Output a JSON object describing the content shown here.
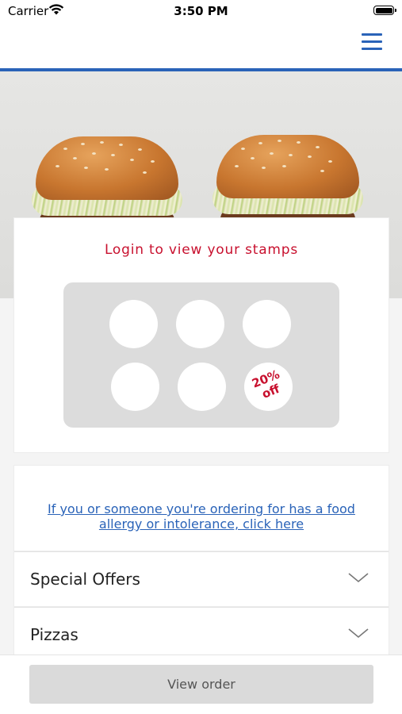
{
  "status_bar": {
    "carrier": "Carrier",
    "time": "3:50 PM"
  },
  "header": {
    "menu_icon": "hamburger-menu-icon"
  },
  "colors": {
    "brand_blue": "#2a63b8",
    "brand_red": "#c8102e"
  },
  "stamps": {
    "title": "Login to view your stamps",
    "reward_label": "20% off"
  },
  "allergy": {
    "link_text": "If you or someone you're ordering for has a food allergy or intolerance, click here"
  },
  "menu": {
    "sections": [
      {
        "label": "Special Offers",
        "icon": "chevron-down-icon"
      },
      {
        "label": "Pizzas",
        "icon": "chevron-down-icon"
      }
    ]
  },
  "footer": {
    "view_order_label": "View order"
  }
}
